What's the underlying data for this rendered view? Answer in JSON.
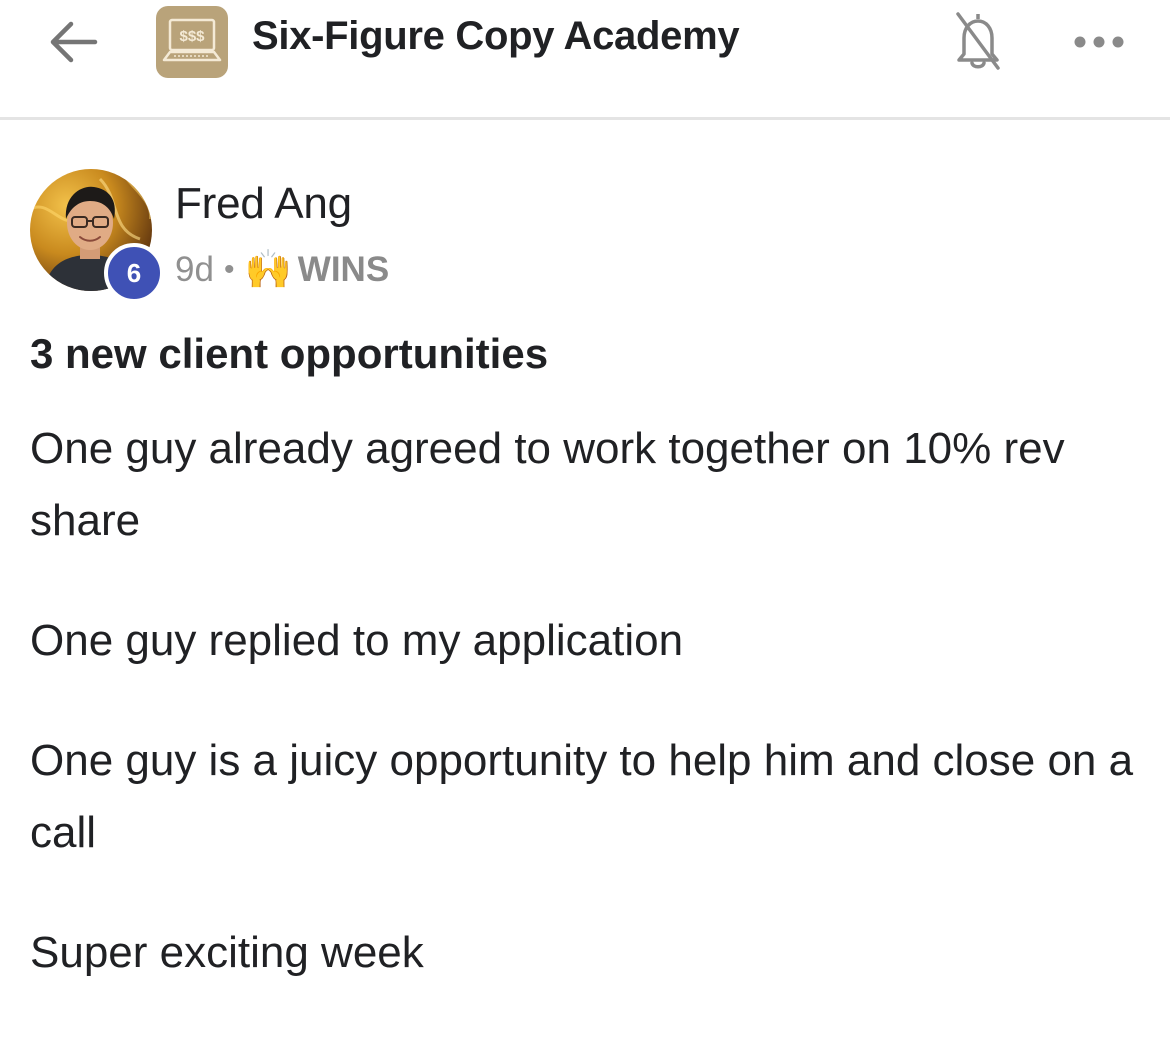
{
  "header": {
    "back_icon": "arrow-left-icon",
    "group_logo_icon": "laptop-money-icon",
    "group_logo_text": "$$$",
    "group_title": "Six-Figure Copy Academy",
    "bell_icon": "bell-off-icon",
    "more_icon": "more-horizontal-icon"
  },
  "post": {
    "author": {
      "name": "Fred Ang",
      "level": "6"
    },
    "time_ago": "9d",
    "separator": "•",
    "category": {
      "emoji": "🙌",
      "label": "WINS"
    },
    "title": "3 new client opportunities",
    "paragraphs": [
      "One guy already agreed to work together on 10% rev share",
      "One guy replied to my application",
      "One guy is a juicy opportunity to help him and close on a call",
      "Super exciting week"
    ]
  },
  "colors": {
    "badge": "#3f51b5",
    "logo_bg": "#b9a37a",
    "meta_gray": "#909090"
  }
}
